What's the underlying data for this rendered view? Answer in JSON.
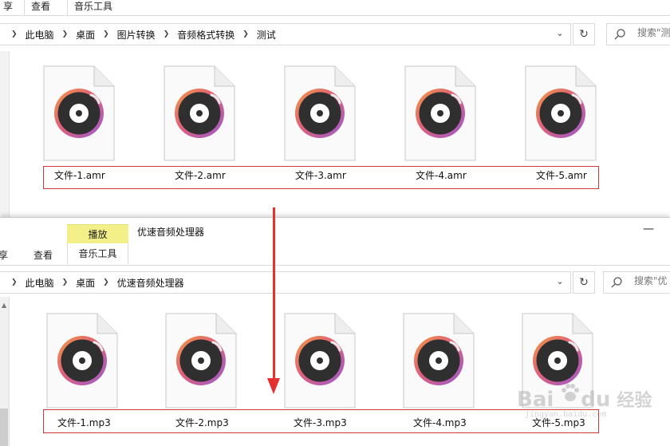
{
  "top_window": {
    "tabs": [
      {
        "label": "享"
      },
      {
        "label": "查看"
      },
      {
        "label": "音乐工具"
      }
    ],
    "breadcrumb": [
      "此电脑",
      "桌面",
      "图片转换",
      "音频格式转换",
      "测试"
    ],
    "search_placeholder": "搜索\"测",
    "files": [
      {
        "name": "文件-1.amr"
      },
      {
        "name": "文件-2.amr"
      },
      {
        "name": "文件-3.amr"
      },
      {
        "name": "文件-4.amr"
      },
      {
        "name": "文件-5.amr"
      }
    ]
  },
  "bottom_window": {
    "context_tab": "播放",
    "context_tools": "音乐工具",
    "title": "优速音频处理器",
    "minimize_glyph": "—",
    "tabs": [
      {
        "label": "享"
      },
      {
        "label": "查看"
      }
    ],
    "breadcrumb": [
      "此电脑",
      "桌面",
      "优速音频处理器"
    ],
    "search_placeholder": "搜索\"优",
    "files": [
      {
        "name": "文件-1.mp3"
      },
      {
        "name": "文件-2.mp3"
      },
      {
        "name": "文件-3.mp3"
      },
      {
        "name": "文件-4.mp3"
      },
      {
        "name": "文件-5.mp3"
      }
    ]
  },
  "watermark": {
    "text": "Bai",
    "text2": "经验",
    "sub": "jingyan.baidu.com"
  },
  "colors": {
    "highlight_box": "#d23a3a",
    "arrow": "#e53030",
    "context_tab": "#f3f08a",
    "icon_ring_orange": "#f08a4b",
    "icon_ring_purple": "#a558c8",
    "icon_disc": "#2e2e2e"
  },
  "icons": {
    "file": "music-file-icon",
    "search": "search-icon",
    "refresh": "refresh-icon",
    "dropdown": "chevron-down-icon"
  }
}
